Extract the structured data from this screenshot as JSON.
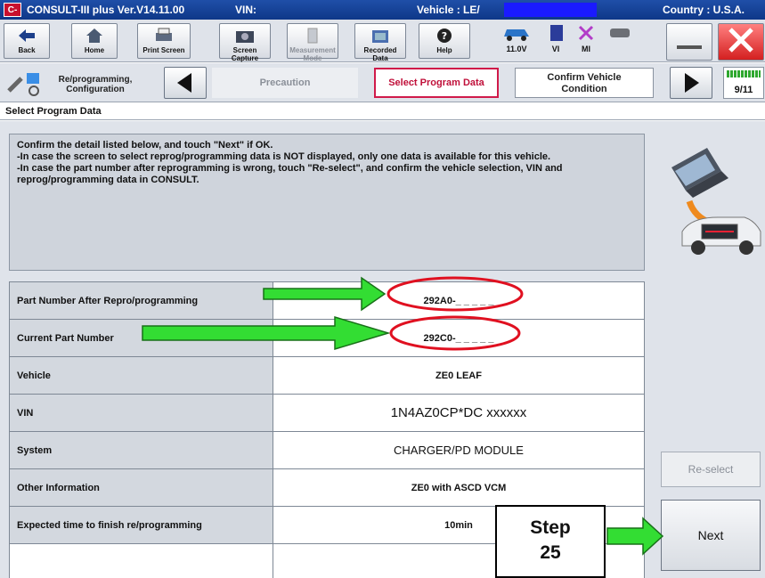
{
  "titlebar": {
    "logo": "C-III",
    "app": "CONSULT-III plus  Ver.V14.11.00",
    "vin_label": "VIN:",
    "vehicle": "Vehicle : LE/",
    "country": "Country : U.S.A."
  },
  "toolbar": {
    "back": "Back",
    "home": "Home",
    "print": "Print Screen",
    "capture": "Screen Capture",
    "measurement": "Measurement Mode",
    "recorded": "Recorded Data",
    "help": "Help",
    "voltage": "11.0V",
    "vi": "VI",
    "mi": "MI"
  },
  "stepbar": {
    "mode": "Re/programming, Configuration",
    "steps": [
      "Precaution",
      "Select Program Data",
      "Confirm Vehicle Condition"
    ],
    "progress": "9/11"
  },
  "section_title": "Select Program Data",
  "instructions": [
    "Confirm the detail listed below, and touch \"Next\" if OK.",
    "-In case the screen to select reprog/programming data is NOT displayed, only one data is available for this vehicle.",
    "-In case the part number after reprogramming is wrong, touch \"Re-select\", and confirm the vehicle selection, VIN and reprog/programming data in CONSULT."
  ],
  "rows": [
    {
      "label": "Part Number After Repro/programming",
      "value": "292A0-_ _ _ _ _"
    },
    {
      "label": "Current Part Number",
      "value": "292C0-_ _ _ _ _"
    },
    {
      "label": "Vehicle",
      "value": "ZE0 LEAF"
    },
    {
      "label": "VIN",
      "value": "1N4AZ0CP*DC xxxxxx"
    },
    {
      "label": "System",
      "value": "CHARGER/PD MODULE"
    },
    {
      "label": "Other Information",
      "value": "ZE0 with ASCD VCM"
    },
    {
      "label": "Expected time to finish re/programming",
      "value": "10min"
    }
  ],
  "buttons": {
    "reselect": "Re-select",
    "next": "Next"
  },
  "callout": {
    "step_word": "Step",
    "step_num": "25"
  },
  "colors": {
    "title_blue": "#1f4fa8",
    "current_step": "#d01a4a",
    "arrow_green": "#33dd33",
    "callout_red": "#e01020"
  }
}
